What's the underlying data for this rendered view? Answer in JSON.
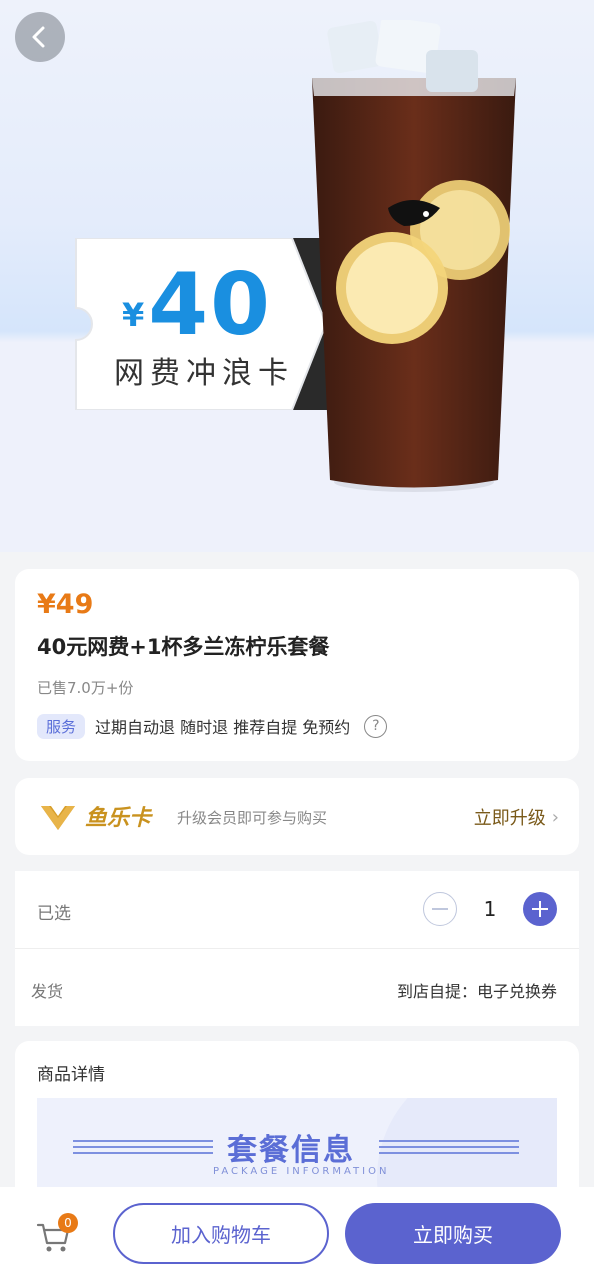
{
  "hero": {
    "ticket_currency": "¥",
    "ticket_amount": "40",
    "ticket_name": "网费冲浪卡",
    "icons": [
      "back-arrow-icon",
      "drink-image",
      "ticket-image"
    ]
  },
  "product": {
    "price": "¥49",
    "title": "40元网费+1杯多兰冻柠乐套餐",
    "sold": "已售7.0万+份",
    "service_tag": "服务",
    "service_text": "过期自动退 随时退 推荐自提 免预约",
    "help_icon": "?"
  },
  "vip": {
    "name": "鱼乐卡",
    "description": "升级会员即可参与购买",
    "upgrade_label": "立即升级",
    "chevron": "›"
  },
  "selection": {
    "label": "已选",
    "quantity": "1",
    "shipping_label": "发货",
    "shipping_value": "到店自提：电子兑换券"
  },
  "detail": {
    "title": "商品详情",
    "banner_title": "套餐信息",
    "banner_subtitle": "PACKAGE INFORMATION"
  },
  "bottom_bar": {
    "cart_count": "0",
    "add_to_cart": "加入购物车",
    "buy_now": "立即购买"
  },
  "colors": {
    "accent": "#5b63cf",
    "price": "#e87a16",
    "vip_gold": "#c9921f",
    "ticket_blue": "#1a8fe0"
  }
}
